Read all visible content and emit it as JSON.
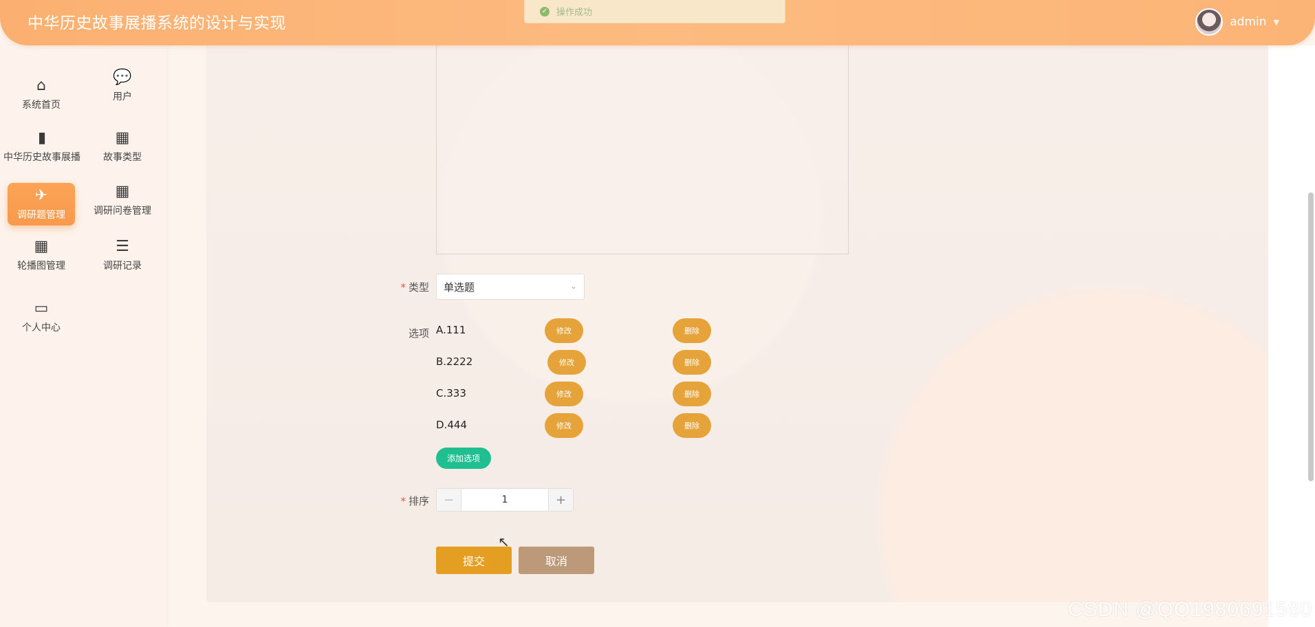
{
  "app": {
    "title": "中华历史故事展播系统的设计与实现",
    "user_name": "admin"
  },
  "toast": {
    "message": "操作成功"
  },
  "sidebar": {
    "items": [
      {
        "label": "系统首页",
        "icon": "home-icon",
        "glyph": "⌂"
      },
      {
        "label": "用户",
        "icon": "chat-icon",
        "glyph": "💬"
      },
      {
        "label": "中华历史故事展播",
        "icon": "bar-chart-icon",
        "glyph": "▮"
      },
      {
        "label": "故事类型",
        "icon": "grid-icon",
        "glyph": "▦"
      },
      {
        "label": "调研题管理",
        "icon": "paper-plane-icon",
        "glyph": "✈",
        "active": true
      },
      {
        "label": "调研问卷管理",
        "icon": "grid-icon",
        "glyph": "▦"
      },
      {
        "label": "轮播图管理",
        "icon": "grid-icon",
        "glyph": "▦"
      },
      {
        "label": "调研记录",
        "icon": "list-indent-icon",
        "glyph": "☰"
      },
      {
        "label": "个人中心",
        "icon": "wallet-icon",
        "glyph": "▭"
      }
    ]
  },
  "form": {
    "type_label": "类型",
    "type_value": "单选题",
    "options_label": "选项",
    "options": [
      {
        "text": "A.111"
      },
      {
        "text": "B.2222"
      },
      {
        "text": "C.333"
      },
      {
        "text": "D.444"
      }
    ],
    "edit_label": "修改",
    "delete_label": "删除",
    "add_option_label": "添加选项",
    "sort_label": "排序",
    "sort_value": "1",
    "minus": "−",
    "plus": "+",
    "submit_label": "提交",
    "cancel_label": "取消"
  },
  "watermark": "CSDN @QQ1980691580",
  "colors": {
    "header": "#fdb877",
    "active_nav": "#f79a4e",
    "pill": "#e5a33a",
    "add_option": "#1fbf8f",
    "submit": "#e49e21",
    "cancel": "#bc9978"
  }
}
